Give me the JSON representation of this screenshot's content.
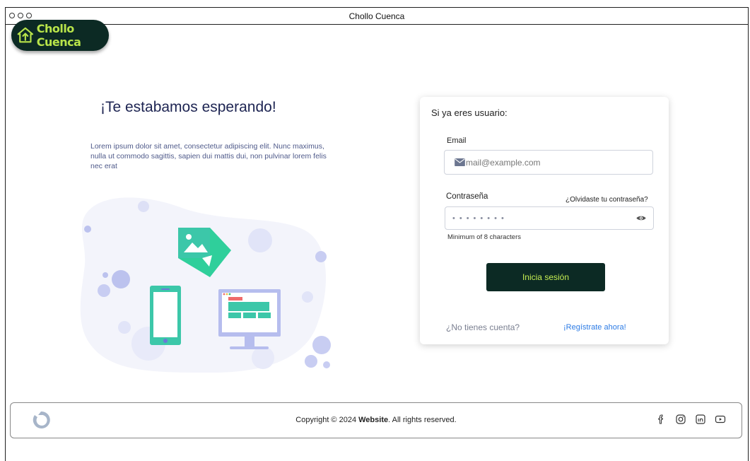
{
  "window": {
    "title": "Chollo Cuenca"
  },
  "logo": {
    "text": "Chollo Cuenca"
  },
  "hero": {
    "title": "¡Te estabamos esperando!",
    "text": "Lorem ipsum dolor sit amet, consectetur adipiscing elit. Nunc maximus, nulla ut commodo sagittis, sapien dui mattis dui, non pulvinar lorem felis nec erat"
  },
  "login": {
    "title": "Si ya eres usuario:",
    "email_label": "Email",
    "email_placeholder": "mail@example.com",
    "password_label": "Contraseña",
    "password_value": "••••••••",
    "forgot": "¿Olvidaste tu contraseña?",
    "hint": "Minimum of 8 characters",
    "submit": "Inicia sesión",
    "no_account": "¿No tienes cuenta?",
    "register": "¡Regístrate ahora!"
  },
  "footer": {
    "copyright_prefix": "Copyright © 2024 ",
    "copyright_brand": "Website",
    "copyright_suffix": ". All rights reserved."
  },
  "colors": {
    "brand_dark": "#0c2a24",
    "brand_accent": "#c6ee52",
    "link": "#2c7be5"
  },
  "icons": [
    "facebook-icon",
    "instagram-icon",
    "linkedin-icon",
    "youtube-icon",
    "eye-icon",
    "mail-icon"
  ]
}
